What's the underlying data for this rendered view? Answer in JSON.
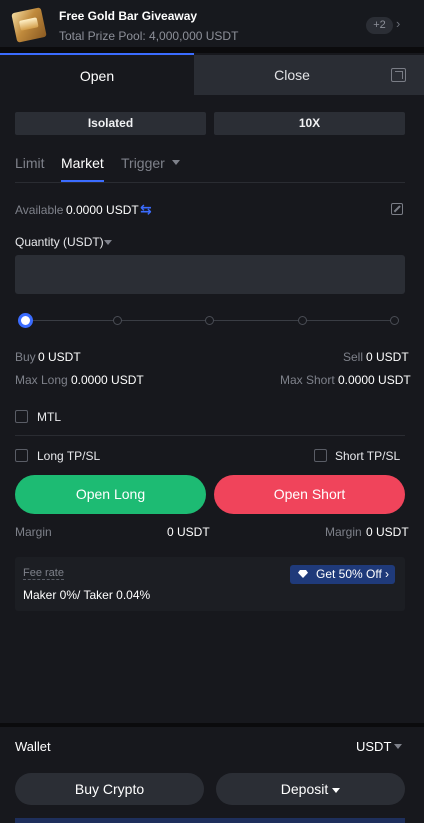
{
  "banner": {
    "title": "Free Gold Bar Giveaway",
    "subtitle": "Total Prize Pool: 4,000,000 USDT",
    "badge": "+2"
  },
  "tabs": {
    "open": "Open",
    "close": "Close"
  },
  "mode": {
    "margin": "Isolated",
    "leverage": "10X"
  },
  "order_types": {
    "limit": "Limit",
    "market": "Market",
    "trigger": "Trigger"
  },
  "available": {
    "label": "Available",
    "value": "0.0000 USDT"
  },
  "quantity": {
    "label": "Quantity (USDT)",
    "value": "",
    "placeholder": ""
  },
  "slider": {
    "value_percent": 0
  },
  "summary": {
    "buy_label": "Buy",
    "buy_value": "0 USDT",
    "sell_label": "Sell",
    "sell_value": "0 USDT",
    "max_long_label": "Max Long",
    "max_long_value": "0.0000 USDT",
    "max_short_label": "Max Short",
    "max_short_value": "0.0000 USDT"
  },
  "options": {
    "mtl": "MTL",
    "long_tpsl": "Long TP/SL",
    "short_tpsl": "Short TP/SL"
  },
  "actions": {
    "open_long": "Open Long",
    "open_short": "Open Short"
  },
  "margin": {
    "long_label": "Margin",
    "long_value": "0 USDT",
    "short_label": "Margin",
    "short_value": "0 USDT"
  },
  "fee": {
    "label": "Fee rate",
    "value": "Maker 0%/ Taker 0.04%",
    "promo": "Get 50% Off"
  },
  "wallet": {
    "label": "Wallet",
    "currency": "USDT",
    "buy_crypto": "Buy Crypto",
    "deposit": "Deposit"
  },
  "colors": {
    "accent": "#3b6cff",
    "long": "#1dbb73",
    "short": "#f0445b",
    "background": "#17181d"
  }
}
